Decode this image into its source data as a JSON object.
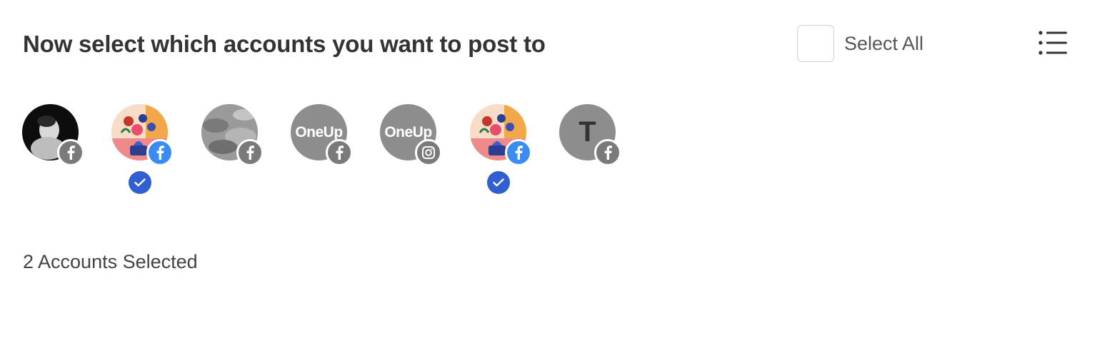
{
  "header": {
    "title": "Now select which accounts you want to post to",
    "select_all_label": "Select All",
    "select_all_checked": false,
    "list_view_icon": "list-icon"
  },
  "accounts": [
    {
      "avatar": "photo-dark-person",
      "network": "facebook",
      "selected": false
    },
    {
      "avatar": "illustration-flowers",
      "network": "facebook",
      "selected": true
    },
    {
      "avatar": "photo-gray-texture",
      "network": "facebook",
      "selected": false
    },
    {
      "avatar": "oneup-logo",
      "avatar_text": "OneUp",
      "network": "facebook",
      "selected": false
    },
    {
      "avatar": "oneup-logo",
      "avatar_text": "OneUp",
      "network": "instagram",
      "selected": false
    },
    {
      "avatar": "illustration-flowers",
      "network": "facebook",
      "selected": true
    },
    {
      "avatar": "letter",
      "avatar_text": "T",
      "network": "facebook",
      "selected": false
    }
  ],
  "summary": {
    "selected_count_text": "2 Accounts Selected"
  },
  "colors": {
    "facebook_active": "#3b8cf0",
    "badge_inactive": "#7a7a7a",
    "check": "#2f5fd0"
  }
}
